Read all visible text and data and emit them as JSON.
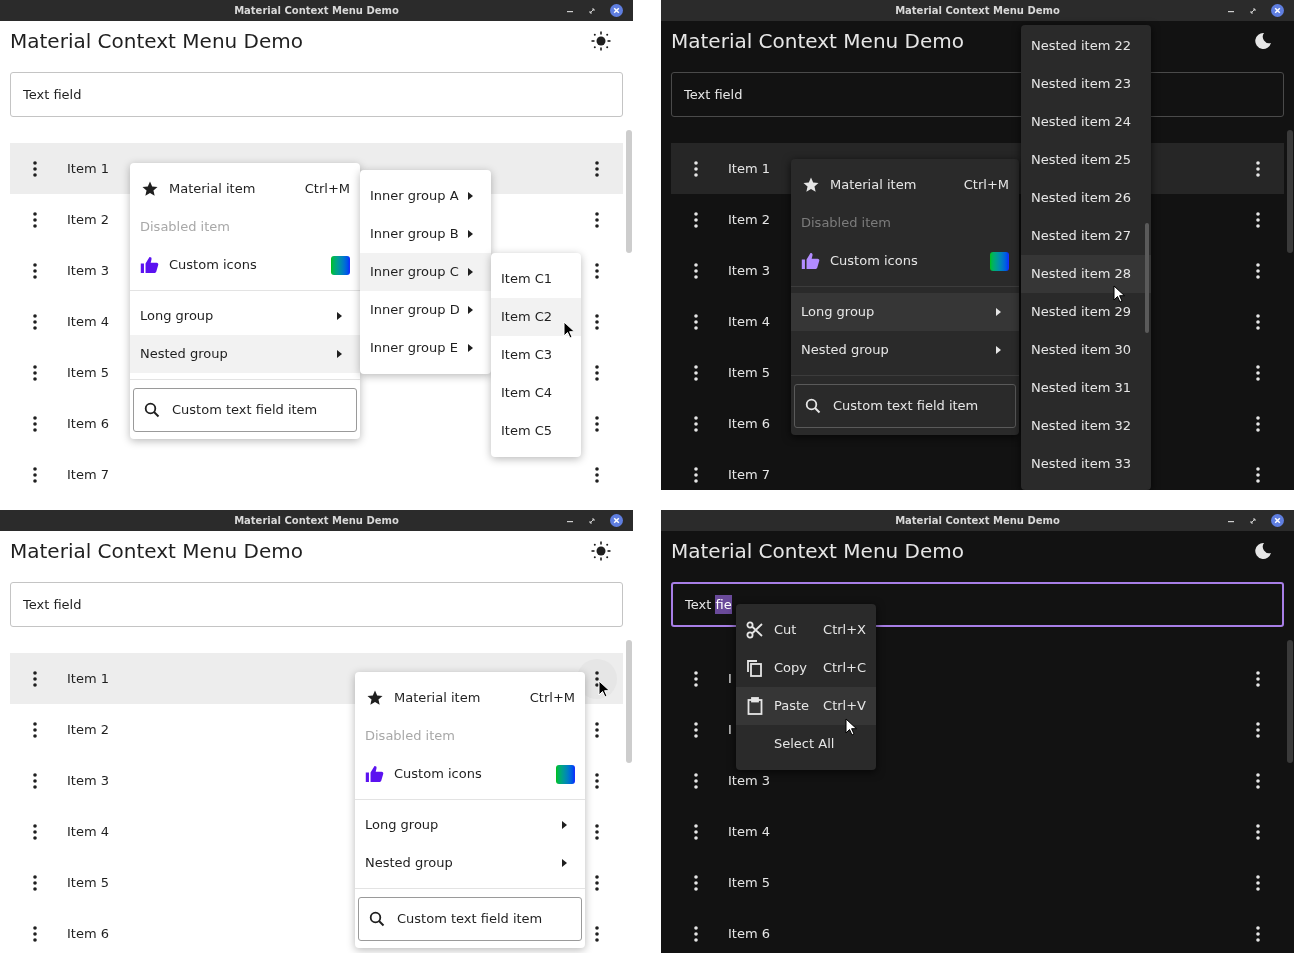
{
  "panes": [
    {
      "dark_theme": false,
      "window_title": "Material Context Menu Demo",
      "app_title": "Material Context Menu Demo",
      "text_field": {
        "value": "Text field",
        "focused": false
      },
      "list": [
        {
          "label": "Item 1",
          "selected": true,
          "button_hovered": false
        },
        {
          "label": "Item 2",
          "selected": false,
          "button_hovered": false
        },
        {
          "label": "Item 3",
          "selected": false,
          "button_hovered": false
        },
        {
          "label": "Item 4",
          "selected": false,
          "button_hovered": false
        },
        {
          "label": "Item 5",
          "selected": false,
          "button_hovered": false
        },
        {
          "label": "Item 6",
          "selected": false,
          "button_hovered": false
        },
        {
          "label": "Item 7",
          "selected": false,
          "button_hovered": false
        }
      ],
      "menus": [
        {
          "items": [
            {
              "kind": "shortcut_item",
              "label": "Material item",
              "shortcut": "Ctrl+M",
              "selected": false
            },
            {
              "kind": "disabled_item",
              "label": "Disabled item",
              "selected": false
            },
            {
              "kind": "custom_item",
              "label": "Custom icons",
              "selected": false
            },
            {
              "kind": "divider"
            },
            {
              "kind": "submenu",
              "label": "Long group",
              "selected": false
            },
            {
              "kind": "submenu",
              "label": "Nested group",
              "selected": true
            },
            {
              "kind": "divider"
            },
            {
              "kind": "search_field",
              "placeholder": "Custom text field item"
            }
          ]
        },
        {
          "items": [
            {
              "kind": "submenu",
              "label": "Inner group A",
              "selected": false
            },
            {
              "kind": "submenu",
              "label": "Inner group B",
              "selected": false
            },
            {
              "kind": "submenu",
              "label": "Inner group C",
              "selected": true
            },
            {
              "kind": "submenu",
              "label": "Inner group D",
              "selected": false
            },
            {
              "kind": "submenu",
              "label": "Inner group E",
              "selected": false
            }
          ]
        },
        {
          "items": [
            {
              "kind": "plain",
              "label": "Item C1",
              "selected": false
            },
            {
              "kind": "plain",
              "label": "Item C2",
              "selected": true
            },
            {
              "kind": "plain",
              "label": "Item C3",
              "selected": false
            },
            {
              "kind": "plain",
              "label": "Item C4",
              "selected": false
            },
            {
              "kind": "plain",
              "label": "Item C5",
              "selected": false
            }
          ]
        }
      ]
    },
    {
      "dark_theme": true,
      "window_title": "Material Context Menu Demo",
      "app_title": "Material Context Menu Demo",
      "text_field": {
        "value": "Text field",
        "focused": false
      },
      "list": [
        {
          "label": "Item 1",
          "selected": true,
          "button_hovered": false
        },
        {
          "label": "Item 2",
          "selected": false,
          "button_hovered": false
        },
        {
          "label": "Item 3",
          "selected": false,
          "button_hovered": false
        },
        {
          "label": "Item 4",
          "selected": false,
          "button_hovered": false
        },
        {
          "label": "Item 5",
          "selected": false,
          "button_hovered": false
        },
        {
          "label": "Item 6",
          "selected": false,
          "button_hovered": false
        },
        {
          "label": "Item 7",
          "selected": false,
          "button_hovered": false
        }
      ],
      "menus": [
        {
          "items": [
            {
              "kind": "shortcut_item",
              "label": "Material item",
              "shortcut": "Ctrl+M",
              "selected": false
            },
            {
              "kind": "disabled_item",
              "label": "Disabled item",
              "selected": false
            },
            {
              "kind": "custom_item",
              "label": "Custom icons",
              "selected": false
            },
            {
              "kind": "divider"
            },
            {
              "kind": "submenu",
              "label": "Long group",
              "selected": true
            },
            {
              "kind": "submenu",
              "label": "Nested group",
              "selected": false
            },
            {
              "kind": "divider"
            },
            {
              "kind": "search_field",
              "placeholder": "Custom text field item"
            }
          ]
        },
        {
          "items": [
            {
              "kind": "plain",
              "label": "Nested item 22",
              "selected": false
            },
            {
              "kind": "plain",
              "label": "Nested item 23",
              "selected": false
            },
            {
              "kind": "plain",
              "label": "Nested item 24",
              "selected": false
            },
            {
              "kind": "plain",
              "label": "Nested item 25",
              "selected": false
            },
            {
              "kind": "plain",
              "label": "Nested item 26",
              "selected": false
            },
            {
              "kind": "plain",
              "label": "Nested item 27",
              "selected": false
            },
            {
              "kind": "plain",
              "label": "Nested item 28",
              "selected": true
            },
            {
              "kind": "plain",
              "label": "Nested item 29",
              "selected": false
            },
            {
              "kind": "plain",
              "label": "Nested item 30",
              "selected": false
            },
            {
              "kind": "plain",
              "label": "Nested item 31",
              "selected": false
            },
            {
              "kind": "plain",
              "label": "Nested item 32",
              "selected": false
            },
            {
              "kind": "plain",
              "label": "Nested item 33",
              "selected": false
            }
          ]
        }
      ]
    },
    {
      "dark_theme": false,
      "window_title": "Material Context Menu Demo",
      "app_title": "Material Context Menu Demo",
      "text_field": {
        "value": "Text field",
        "focused": false
      },
      "list": [
        {
          "label": "Item 1",
          "selected": true,
          "button_hovered": true
        },
        {
          "label": "Item 2",
          "selected": false,
          "button_hovered": false
        },
        {
          "label": "Item 3",
          "selected": false,
          "button_hovered": false
        },
        {
          "label": "Item 4",
          "selected": false,
          "button_hovered": false
        },
        {
          "label": "Item 5",
          "selected": false,
          "button_hovered": false
        },
        {
          "label": "Item 6",
          "selected": false,
          "button_hovered": false
        }
      ],
      "menus": [
        {
          "items": [
            {
              "kind": "shortcut_item",
              "label": "Material item",
              "shortcut": "Ctrl+M",
              "selected": false
            },
            {
              "kind": "disabled_item",
              "label": "Disabled item",
              "selected": false
            },
            {
              "kind": "custom_item",
              "label": "Custom icons",
              "selected": false
            },
            {
              "kind": "divider"
            },
            {
              "kind": "submenu",
              "label": "Long group",
              "selected": false
            },
            {
              "kind": "submenu",
              "label": "Nested group",
              "selected": false
            },
            {
              "kind": "divider"
            },
            {
              "kind": "search_field",
              "placeholder": "Custom text field item"
            }
          ]
        }
      ]
    },
    {
      "dark_theme": true,
      "window_title": "Material Context Menu Demo",
      "app_title": "Material Context Menu Demo",
      "text_field": {
        "value": "Text ",
        "selected_text": "fie",
        "focused": true
      },
      "list": [
        {
          "label": "I",
          "selected": false,
          "button_hovered": false
        },
        {
          "label": "I",
          "selected": false,
          "button_hovered": false
        },
        {
          "label": "Item 3",
          "selected": false,
          "button_hovered": false
        },
        {
          "label": "Item 4",
          "selected": false,
          "button_hovered": false
        },
        {
          "label": "Item 5",
          "selected": false,
          "button_hovered": false
        },
        {
          "label": "Item 6",
          "selected": false,
          "button_hovered": false
        }
      ],
      "menus": [
        {
          "items": [
            {
              "kind": "cut",
              "label": "Cut",
              "shortcut": "Ctrl+X",
              "selected": false
            },
            {
              "kind": "copy",
              "label": "Copy",
              "shortcut": "Ctrl+C",
              "selected": false
            },
            {
              "kind": "paste",
              "label": "Paste",
              "shortcut": "Ctrl+V",
              "selected": true
            },
            {
              "kind": "indented",
              "label": "Select All",
              "selected": false
            }
          ]
        }
      ]
    }
  ]
}
